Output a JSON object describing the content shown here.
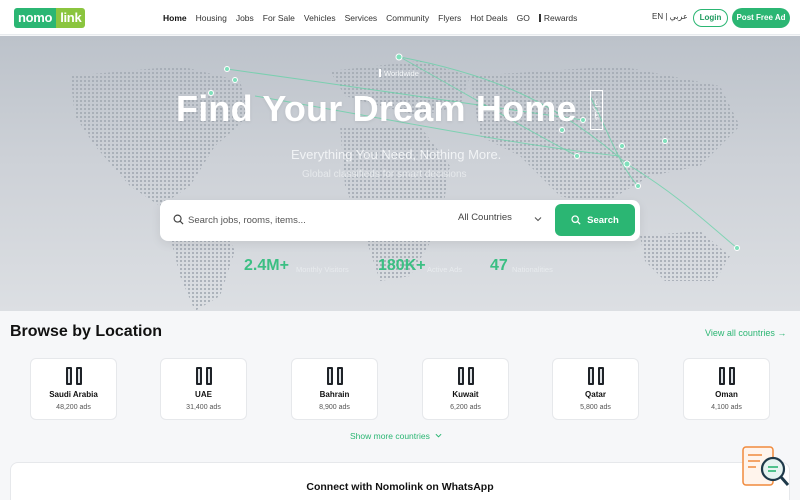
{
  "brand": {
    "logo_part1": "nomo",
    "logo_part2": "link",
    "green": "#2bb673",
    "lime": "#8bc53f"
  },
  "nav": {
    "items": [
      {
        "label": "Home",
        "active": true
      },
      {
        "label": "Housing"
      },
      {
        "label": "Jobs"
      },
      {
        "label": "For Sale"
      },
      {
        "label": "Vehicles"
      },
      {
        "label": "Services"
      },
      {
        "label": "Community"
      },
      {
        "label": "Flyers"
      },
      {
        "label": "Hot Deals"
      },
      {
        "label": "GO"
      },
      {
        "label": "Rewards"
      }
    ],
    "lang": "EN | عربي",
    "login": "Login",
    "post": "Post Free Ad"
  },
  "hero": {
    "badge": "Worldwide",
    "title": "Find Your Dream Home",
    "vertical_tag": "عقارات",
    "subtitle": "Everything You Need, Nothing More.",
    "subtitle2": "Global classifieds for smart decisions",
    "search_placeholder": "Search jobs, rooms, items...",
    "country_select": "All Countries",
    "search_button": "Search",
    "stats": [
      {
        "value": "2.4M+",
        "label": "Monthly Visitors"
      },
      {
        "value": "180K+",
        "label": "Active Ads"
      },
      {
        "value": "47",
        "label": "Nationalities"
      }
    ]
  },
  "browse": {
    "title": "Browse by Location",
    "view_all": "View all countries →",
    "countries": [
      {
        "name": "Saudi Arabia",
        "ads": "48,200 ads"
      },
      {
        "name": "UAE",
        "ads": "31,400 ads"
      },
      {
        "name": "Bahrain",
        "ads": "8,900 ads"
      },
      {
        "name": "Kuwait",
        "ads": "6,200 ads"
      },
      {
        "name": "Qatar",
        "ads": "5,800 ads"
      },
      {
        "name": "Oman",
        "ads": "4,100 ads"
      }
    ],
    "show_more": "Show more countries"
  },
  "whatsapp": {
    "title": "Connect with Nomolink on WhatsApp"
  }
}
